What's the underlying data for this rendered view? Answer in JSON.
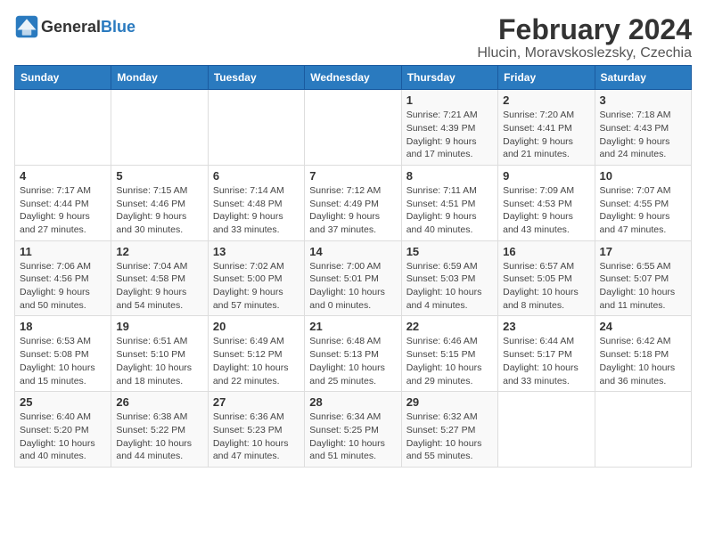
{
  "logo": {
    "general": "General",
    "blue": "Blue"
  },
  "title": "February 2024",
  "subtitle": "Hlucin, Moravskoslezsky, Czechia",
  "weekdays": [
    "Sunday",
    "Monday",
    "Tuesday",
    "Wednesday",
    "Thursday",
    "Friday",
    "Saturday"
  ],
  "weeks": [
    [
      {
        "day": "",
        "detail": ""
      },
      {
        "day": "",
        "detail": ""
      },
      {
        "day": "",
        "detail": ""
      },
      {
        "day": "",
        "detail": ""
      },
      {
        "day": "1",
        "detail": "Sunrise: 7:21 AM\nSunset: 4:39 PM\nDaylight: 9 hours\nand 17 minutes."
      },
      {
        "day": "2",
        "detail": "Sunrise: 7:20 AM\nSunset: 4:41 PM\nDaylight: 9 hours\nand 21 minutes."
      },
      {
        "day": "3",
        "detail": "Sunrise: 7:18 AM\nSunset: 4:43 PM\nDaylight: 9 hours\nand 24 minutes."
      }
    ],
    [
      {
        "day": "4",
        "detail": "Sunrise: 7:17 AM\nSunset: 4:44 PM\nDaylight: 9 hours\nand 27 minutes."
      },
      {
        "day": "5",
        "detail": "Sunrise: 7:15 AM\nSunset: 4:46 PM\nDaylight: 9 hours\nand 30 minutes."
      },
      {
        "day": "6",
        "detail": "Sunrise: 7:14 AM\nSunset: 4:48 PM\nDaylight: 9 hours\nand 33 minutes."
      },
      {
        "day": "7",
        "detail": "Sunrise: 7:12 AM\nSunset: 4:49 PM\nDaylight: 9 hours\nand 37 minutes."
      },
      {
        "day": "8",
        "detail": "Sunrise: 7:11 AM\nSunset: 4:51 PM\nDaylight: 9 hours\nand 40 minutes."
      },
      {
        "day": "9",
        "detail": "Sunrise: 7:09 AM\nSunset: 4:53 PM\nDaylight: 9 hours\nand 43 minutes."
      },
      {
        "day": "10",
        "detail": "Sunrise: 7:07 AM\nSunset: 4:55 PM\nDaylight: 9 hours\nand 47 minutes."
      }
    ],
    [
      {
        "day": "11",
        "detail": "Sunrise: 7:06 AM\nSunset: 4:56 PM\nDaylight: 9 hours\nand 50 minutes."
      },
      {
        "day": "12",
        "detail": "Sunrise: 7:04 AM\nSunset: 4:58 PM\nDaylight: 9 hours\nand 54 minutes."
      },
      {
        "day": "13",
        "detail": "Sunrise: 7:02 AM\nSunset: 5:00 PM\nDaylight: 9 hours\nand 57 minutes."
      },
      {
        "day": "14",
        "detail": "Sunrise: 7:00 AM\nSunset: 5:01 PM\nDaylight: 10 hours\nand 0 minutes."
      },
      {
        "day": "15",
        "detail": "Sunrise: 6:59 AM\nSunset: 5:03 PM\nDaylight: 10 hours\nand 4 minutes."
      },
      {
        "day": "16",
        "detail": "Sunrise: 6:57 AM\nSunset: 5:05 PM\nDaylight: 10 hours\nand 8 minutes."
      },
      {
        "day": "17",
        "detail": "Sunrise: 6:55 AM\nSunset: 5:07 PM\nDaylight: 10 hours\nand 11 minutes."
      }
    ],
    [
      {
        "day": "18",
        "detail": "Sunrise: 6:53 AM\nSunset: 5:08 PM\nDaylight: 10 hours\nand 15 minutes."
      },
      {
        "day": "19",
        "detail": "Sunrise: 6:51 AM\nSunset: 5:10 PM\nDaylight: 10 hours\nand 18 minutes."
      },
      {
        "day": "20",
        "detail": "Sunrise: 6:49 AM\nSunset: 5:12 PM\nDaylight: 10 hours\nand 22 minutes."
      },
      {
        "day": "21",
        "detail": "Sunrise: 6:48 AM\nSunset: 5:13 PM\nDaylight: 10 hours\nand 25 minutes."
      },
      {
        "day": "22",
        "detail": "Sunrise: 6:46 AM\nSunset: 5:15 PM\nDaylight: 10 hours\nand 29 minutes."
      },
      {
        "day": "23",
        "detail": "Sunrise: 6:44 AM\nSunset: 5:17 PM\nDaylight: 10 hours\nand 33 minutes."
      },
      {
        "day": "24",
        "detail": "Sunrise: 6:42 AM\nSunset: 5:18 PM\nDaylight: 10 hours\nand 36 minutes."
      }
    ],
    [
      {
        "day": "25",
        "detail": "Sunrise: 6:40 AM\nSunset: 5:20 PM\nDaylight: 10 hours\nand 40 minutes."
      },
      {
        "day": "26",
        "detail": "Sunrise: 6:38 AM\nSunset: 5:22 PM\nDaylight: 10 hours\nand 44 minutes."
      },
      {
        "day": "27",
        "detail": "Sunrise: 6:36 AM\nSunset: 5:23 PM\nDaylight: 10 hours\nand 47 minutes."
      },
      {
        "day": "28",
        "detail": "Sunrise: 6:34 AM\nSunset: 5:25 PM\nDaylight: 10 hours\nand 51 minutes."
      },
      {
        "day": "29",
        "detail": "Sunrise: 6:32 AM\nSunset: 5:27 PM\nDaylight: 10 hours\nand 55 minutes."
      },
      {
        "day": "",
        "detail": ""
      },
      {
        "day": "",
        "detail": ""
      }
    ]
  ]
}
